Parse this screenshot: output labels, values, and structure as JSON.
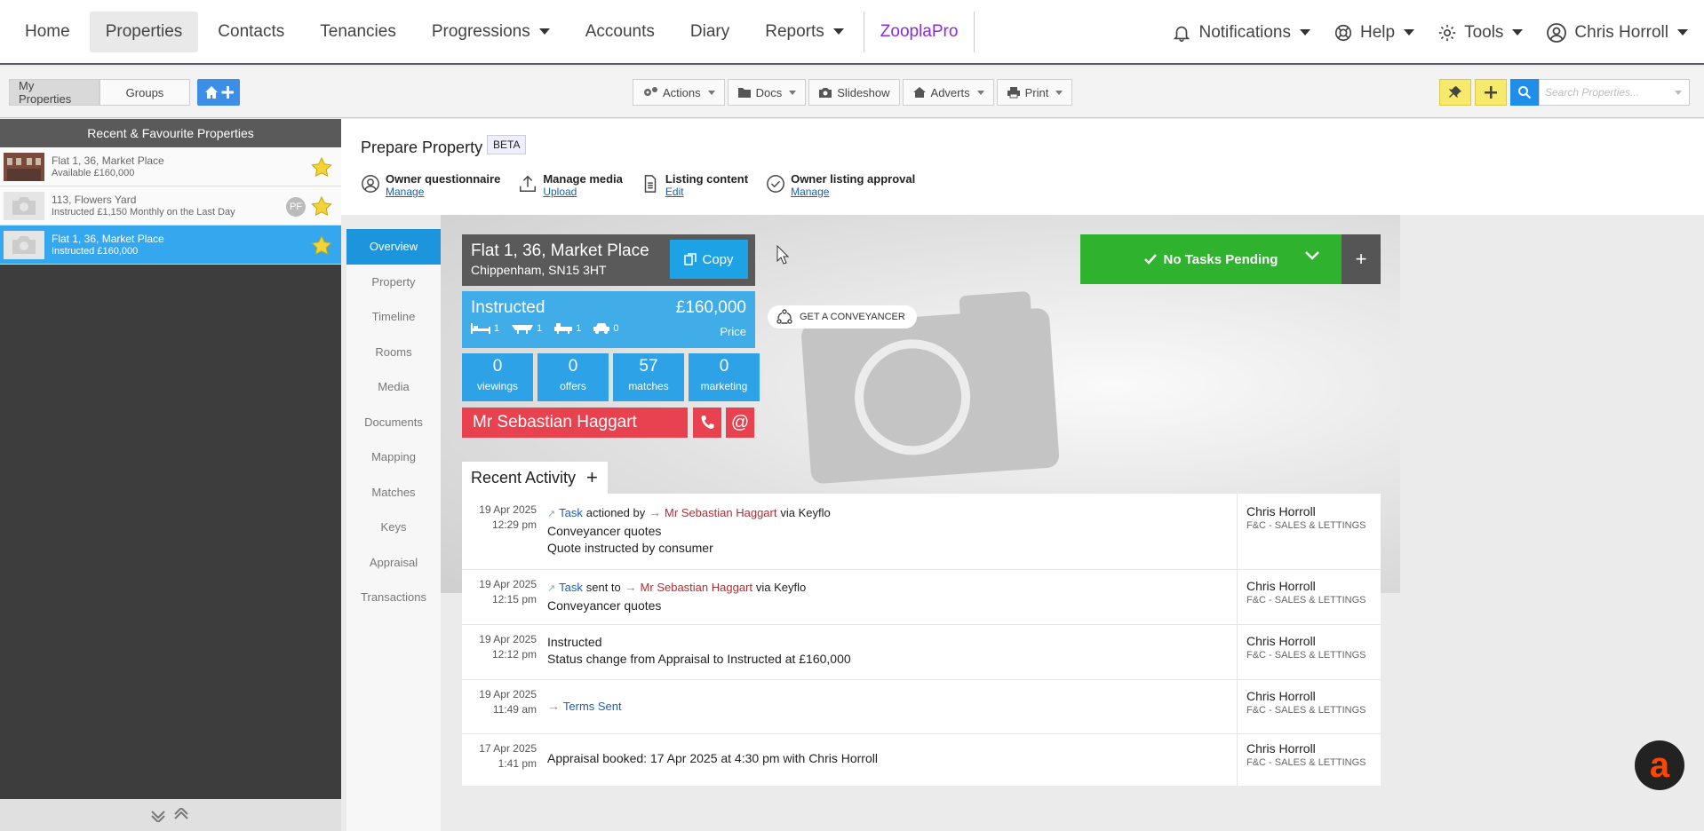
{
  "topnav": {
    "items": [
      "Home",
      "Properties",
      "Contacts",
      "Tenancies",
      "Progressions",
      "Accounts",
      "Diary",
      "Reports",
      "ZooplaPro"
    ],
    "right": [
      "Notifications",
      "Help",
      "Tools",
      "Chris Horroll"
    ]
  },
  "toolbar": {
    "my_properties": "My Properties",
    "groups": "Groups",
    "actions": "Actions",
    "docs": "Docs",
    "slideshow": "Slideshow",
    "adverts": "Adverts",
    "print": "Print",
    "search_placeholder": "Search Properties..."
  },
  "sidebar": {
    "title": "Recent & Favourite Properties",
    "items": [
      {
        "name": "Flat 1, 36, Market Place",
        "sub": "Available £160,000"
      },
      {
        "name": "113, Flowers Yard",
        "sub": "Instructed £1,150 Monthly on the Last Day",
        "badge": "PF"
      },
      {
        "name": "Flat 1, 36, Market Place",
        "sub": "Instructed £160,000"
      }
    ]
  },
  "prepare": {
    "title": "Prepare Property",
    "beta": "BETA",
    "steps": [
      {
        "title": "Owner questionnaire",
        "link": "Manage"
      },
      {
        "title": "Manage media",
        "link": "Upload"
      },
      {
        "title": "Listing content",
        "link": "Edit"
      },
      {
        "title": "Owner listing approval",
        "link": "Manage"
      }
    ]
  },
  "subnav": [
    "Overview",
    "Property",
    "Timeline",
    "Rooms",
    "Media",
    "Documents",
    "Mapping",
    "Matches",
    "Keys",
    "Appraisal",
    "Transactions"
  ],
  "property": {
    "address1": "Flat 1, 36, Market Place",
    "address2": "Chippenham, SN15 3HT",
    "copy": "Copy",
    "status": "Instructed",
    "price": "£160,000",
    "price_label": "Price",
    "beds": "1",
    "receptions": "1",
    "baths": "1",
    "parking": "0",
    "stats": [
      {
        "n": "0",
        "l": "viewings"
      },
      {
        "n": "0",
        "l": "offers"
      },
      {
        "n": "57",
        "l": "matches"
      },
      {
        "n": "0",
        "l": "marketing"
      }
    ],
    "owner": "Mr Sebastian Haggart",
    "conveyancer": "GET A CONVEYANCER",
    "tasks": "No Tasks Pending"
  },
  "activity": {
    "title": "Recent Activity",
    "rows": [
      {
        "date": "19 Apr 2025",
        "time": "12:29 pm",
        "link": "Task",
        "verb": "actioned by",
        "person": "Mr Sebastian Haggart",
        "via": "via Keyflo",
        "line2": "Conveyancer quotes",
        "line3": "Quote instructed by consumer",
        "user": "Chris Horroll",
        "org": "F&C - SALES & LETTINGS"
      },
      {
        "date": "19 Apr 2025",
        "time": "12:15 pm",
        "link": "Task",
        "verb": "sent to",
        "person": "Mr Sebastian Haggart",
        "via": "via Keyflo",
        "line2": "Conveyancer quotes",
        "user": "Chris Horroll",
        "org": "F&C - SALES & LETTINGS"
      },
      {
        "date": "19 Apr 2025",
        "time": "12:12 pm",
        "line1": "Instructed",
        "line2": "Status change from Appraisal to Instructed at £160,000",
        "user": "Chris Horroll",
        "org": "F&C - SALES & LETTINGS"
      },
      {
        "date": "19 Apr 2025",
        "time": "11:49 am",
        "link": "Terms Sent",
        "user": "Chris Horroll",
        "org": "F&C - SALES & LETTINGS"
      },
      {
        "date": "17 Apr 2025",
        "time": "1:41 pm",
        "line1": "Appraisal booked: 17 Apr 2025 at 4:30 pm with Chris Horroll",
        "user": "Chris Horroll",
        "org": "F&C - SALES & LETTINGS"
      }
    ]
  },
  "colors": {
    "primary": "#1d95dc",
    "green": "#2fb32e",
    "red": "#e8414f",
    "zoopla": "#8a2be2"
  }
}
